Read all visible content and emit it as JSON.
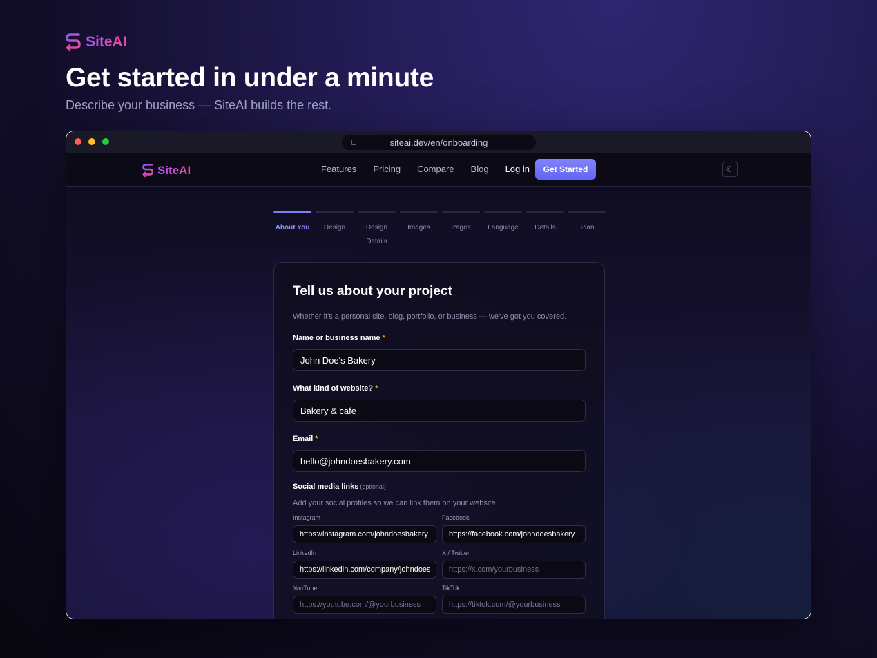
{
  "hero": {
    "brand": "SiteAI",
    "title": "Get started in under a minute",
    "subtitle": "Describe your business — SiteAI builds the rest."
  },
  "browser": {
    "url": "siteai.dev/en/onboarding"
  },
  "nav": {
    "brand": "SiteAI",
    "links": [
      "Features",
      "Pricing",
      "Compare",
      "Blog"
    ],
    "login": "Log in",
    "cta": "Get Started",
    "theme_icon": "moon-icon"
  },
  "steps": [
    {
      "label": "About You",
      "active": true
    },
    {
      "label": "Design",
      "active": false
    },
    {
      "label": "Design Details",
      "active": false
    },
    {
      "label": "Images",
      "active": false
    },
    {
      "label": "Pages",
      "active": false
    },
    {
      "label": "Language",
      "active": false
    },
    {
      "label": "Details",
      "active": false
    },
    {
      "label": "Plan",
      "active": false
    }
  ],
  "form": {
    "title": "Tell us about your project",
    "description": "Whether it's a personal site, blog, portfolio, or business — we've got you covered.",
    "name": {
      "label": "Name or business name",
      "required": "*",
      "value": "John Doe's Bakery"
    },
    "kind": {
      "label": "What kind of website?",
      "required": "*",
      "value": "Bakery & cafe"
    },
    "email": {
      "label": "Email",
      "required": "*",
      "value": "hello@johndoesbakery.com"
    },
    "social": {
      "title": "Social media links",
      "optional": "(optional)",
      "description": "Add your social profiles so we can link them on your website.",
      "instagram": {
        "label": "Instagram",
        "value": "https://instagram.com/johndoesbakery",
        "placeholder": ""
      },
      "facebook": {
        "label": "Facebook",
        "value": "https://facebook.com/johndoesbakery",
        "placeholder": ""
      },
      "linkedin": {
        "label": "LinkedIn",
        "value": "https://linkedin.com/company/johndoesbakery",
        "placeholder": ""
      },
      "twitter": {
        "label": "X / Twitter",
        "value": "",
        "placeholder": "https://x.com/yourbusiness"
      },
      "youtube": {
        "label": "YouTube",
        "value": "",
        "placeholder": "https://youtube.com/@yourbusiness"
      },
      "tiktok": {
        "label": "TikTok",
        "value": "",
        "placeholder": "https://tiktok.com/@yourbusiness"
      }
    }
  },
  "colors": {
    "accent": "#6366f1",
    "required": "#f59e0b",
    "brand_from": "#a855f7",
    "brand_to": "#ec4899"
  }
}
